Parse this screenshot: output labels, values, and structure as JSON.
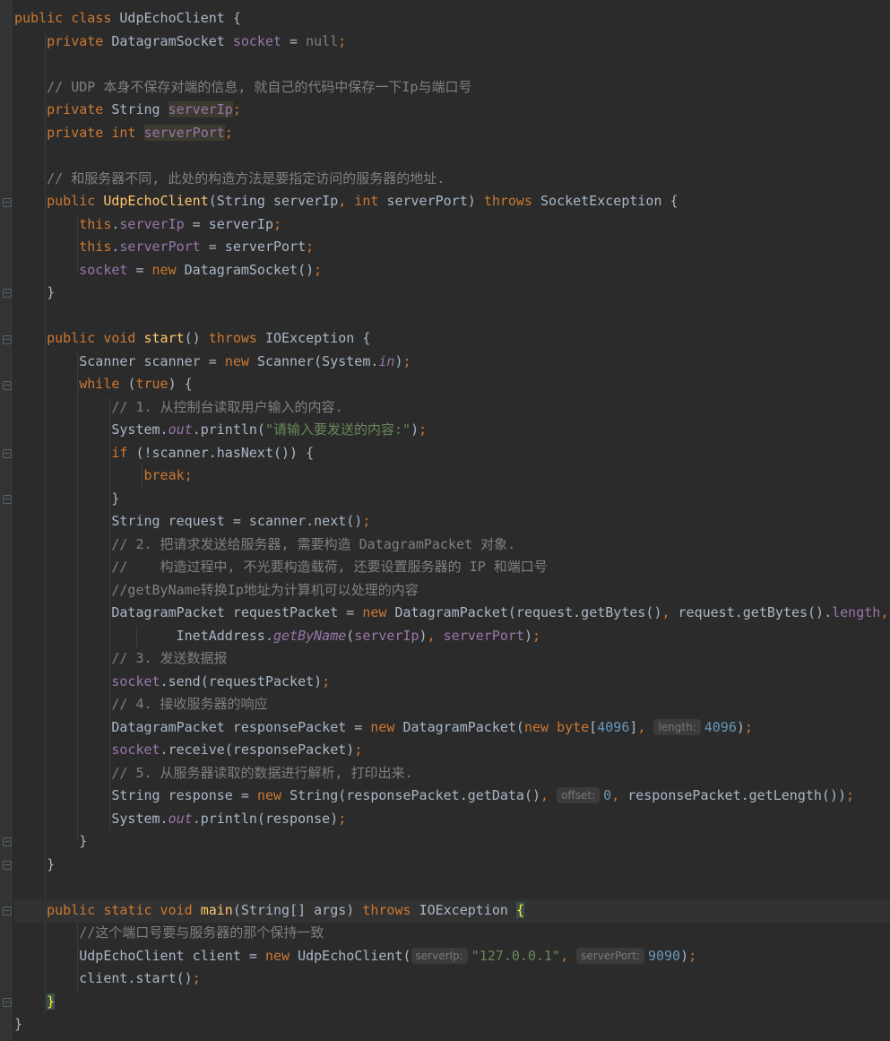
{
  "editor": {
    "language": "java",
    "theme": "darcula",
    "hint_labels": {
      "length": "length:",
      "offset": "offset:",
      "server_ip": "serverIp:",
      "server_port": "serverPort:"
    },
    "comments": {
      "udp_no_state": "// UDP 本身不保存对端的信息, 就自己的代码中保存一下Ip与端口号",
      "ctor_note": "// 和服务器不同, 此处的构造方法是要指定访问的服务器的地址.",
      "step1": "// 1. 从控制台读取用户输入的内容.",
      "step2": "// 2. 把请求发送给服务器, 需要构造 DatagramPacket 对象.",
      "step2b": "//    构造过程中, 不光要构造载荷, 还要设置服务器的 IP 和端口号",
      "getbyname": "//getByName转换Ip地址为计算机可以处理的内容",
      "step3": "// 3. 发送数据报",
      "step4": "// 4. 接收服务器的响应",
      "step5": "// 5. 从服务器读取的数据进行解析, 打印出来.",
      "port_note": "//这个端口号要与服务器的那个保持一致"
    },
    "strings": {
      "prompt": "\"请输入要发送的内容:\"",
      "ip": "\"127.0.0.1\""
    },
    "numbers": {
      "buf": "4096",
      "buf_len": "4096",
      "offset": "0",
      "port": "9090"
    }
  }
}
